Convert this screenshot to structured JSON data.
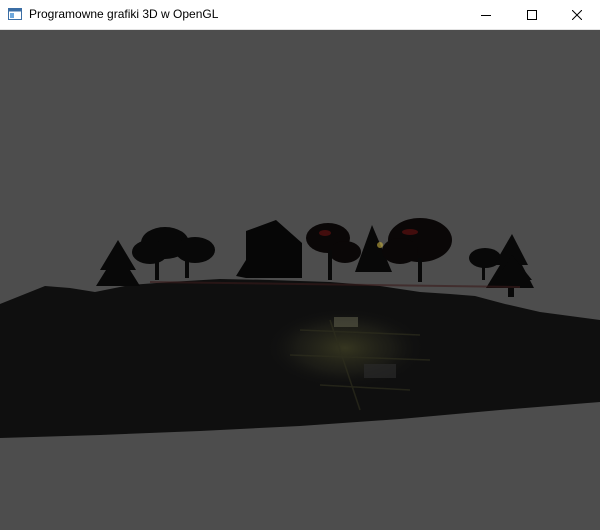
{
  "window": {
    "title": "Programowne grafiki 3D w OpenGL",
    "app_icon": "opengl-window-icon",
    "controls": {
      "minimize_icon": "minimize-icon",
      "maximize_icon": "maximize-icon",
      "close_icon": "close-icon"
    }
  },
  "viewport": {
    "description_icon": "3d-scene",
    "clear_color": "#4d4d4d",
    "ground_color": "#0f0f0f",
    "accent_light": "#d8c86a",
    "tree_accent": "#5a1010"
  }
}
